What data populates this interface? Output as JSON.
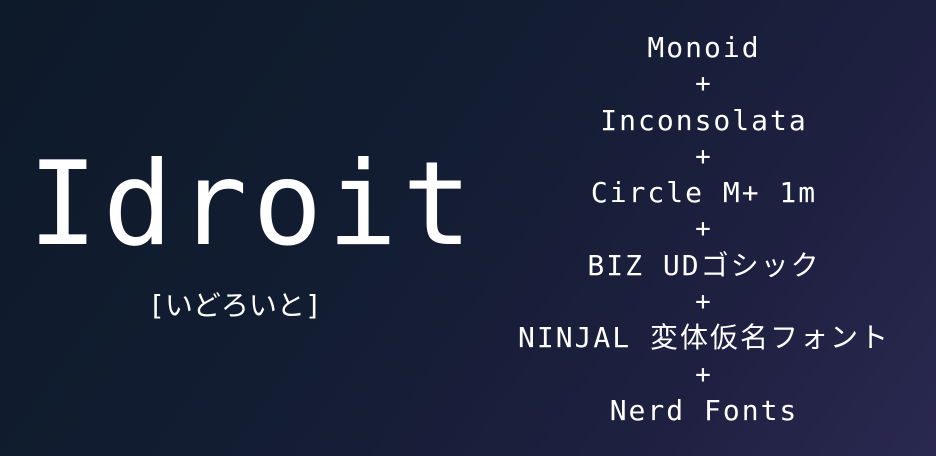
{
  "title": "Idroit",
  "subtitle": "[いどろいと]",
  "credits": {
    "font_1": "Monoid",
    "plus_1": "+",
    "font_2": "Inconsolata",
    "plus_2": "+",
    "font_3": "Circle M+ 1m",
    "plus_3": "+",
    "font_4": "BIZ UDゴシック",
    "plus_4": "+",
    "font_5": "NINJAL 変体仮名フォント",
    "plus_5": "+",
    "font_6": "Nerd Fonts"
  },
  "colors": {
    "background_start": "#0d1a29",
    "background_end": "#2a2850",
    "text": "#ffffff"
  }
}
